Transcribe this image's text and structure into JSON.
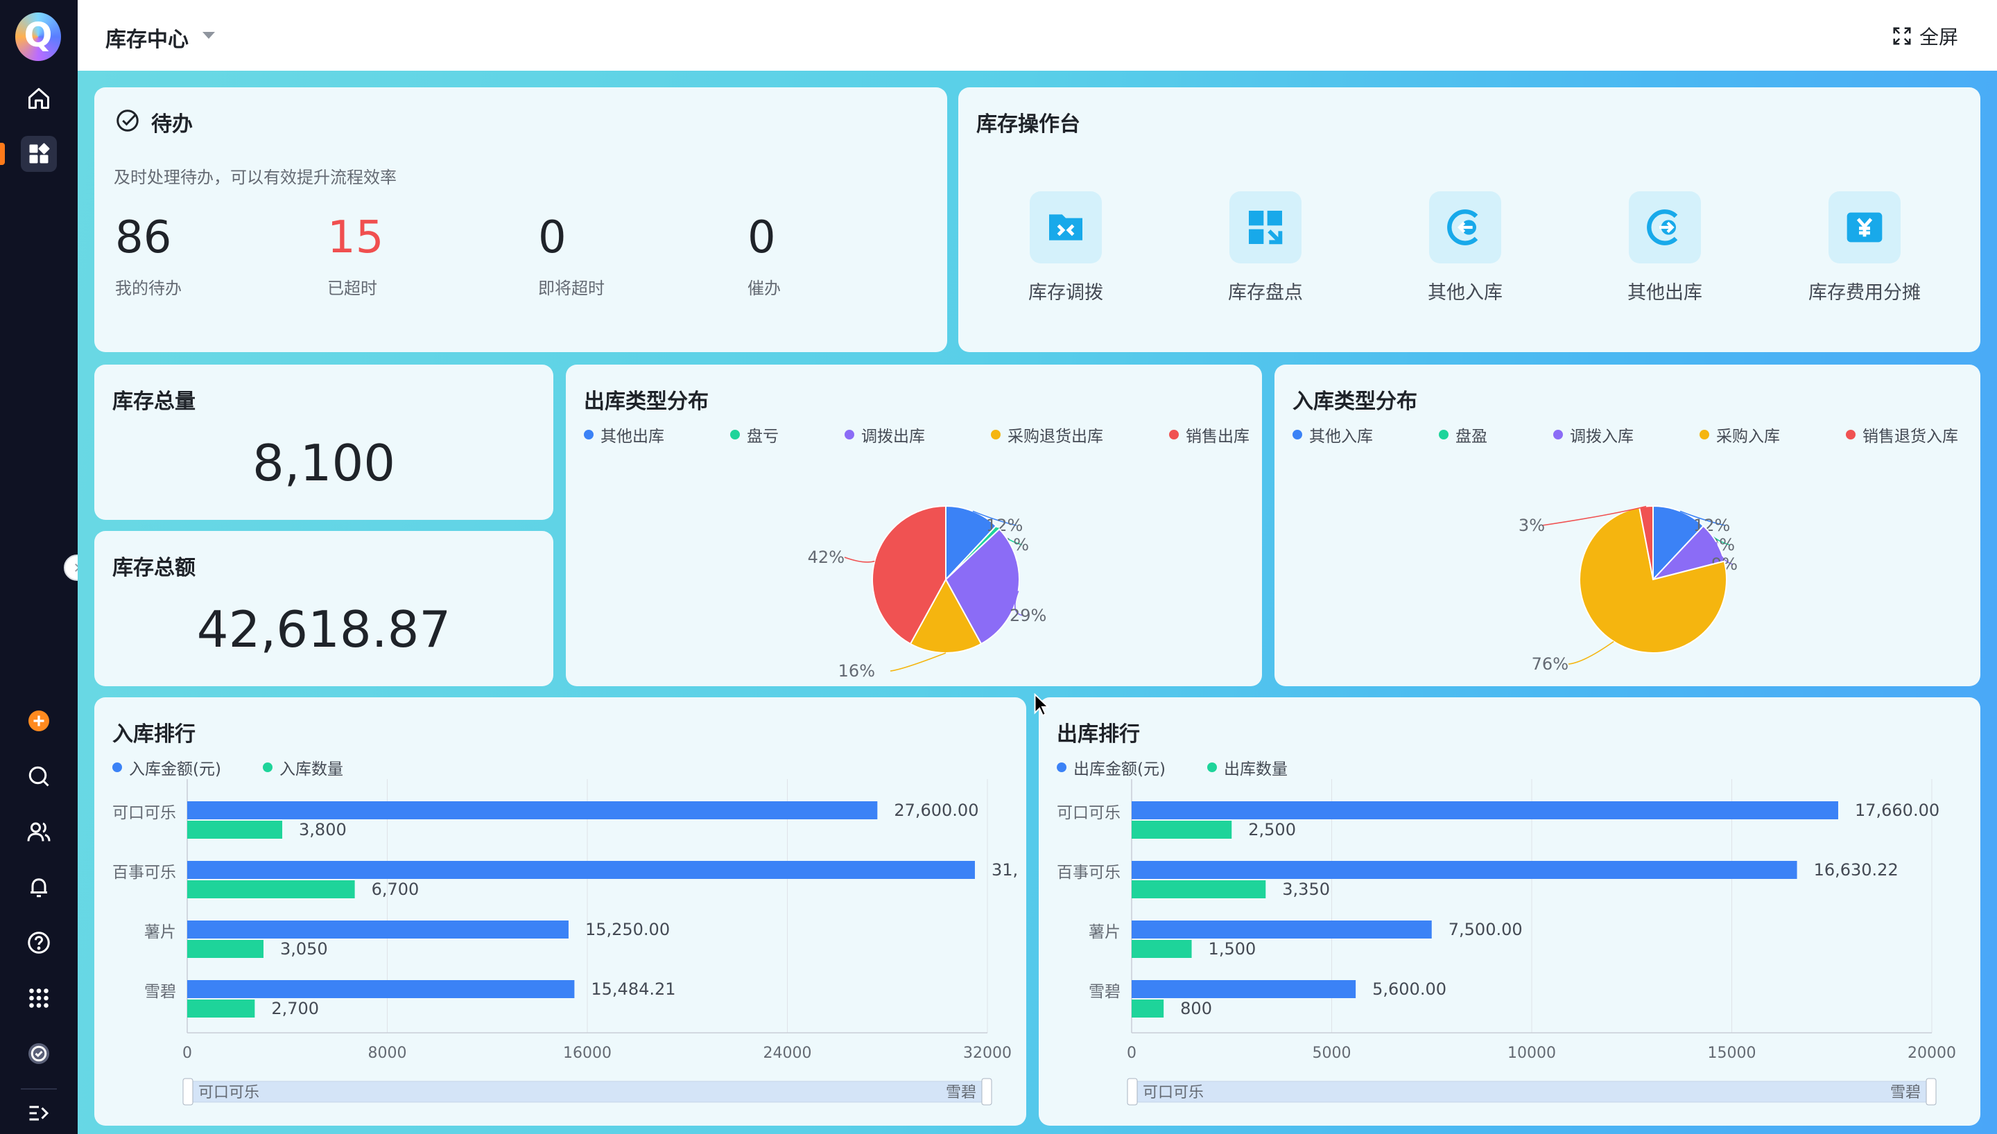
{
  "header": {
    "title": "库存中心",
    "fullscreen_label": "全屏"
  },
  "sidebar": {
    "icons": [
      "home-icon",
      "dashboard-icon",
      "add-icon",
      "search-icon",
      "users-icon",
      "bell-icon",
      "help-icon",
      "apps-icon",
      "check-circle-icon",
      "expand-menu-icon"
    ]
  },
  "todo": {
    "title": "待办",
    "subtitle": "及时处理待办，可以有效提升流程效率",
    "items": [
      {
        "value": "86",
        "label": "我的待办"
      },
      {
        "value": "15",
        "label": "已超时"
      },
      {
        "value": "0",
        "label": "即将超时"
      },
      {
        "value": "0",
        "label": "催办"
      }
    ]
  },
  "ops": {
    "title": "库存操作台",
    "items": [
      {
        "label": "库存调拨",
        "icon": "transfer-icon"
      },
      {
        "label": "库存盘点",
        "icon": "inventory-check-icon"
      },
      {
        "label": "其他入库",
        "icon": "stock-in-icon"
      },
      {
        "label": "其他出库",
        "icon": "stock-out-icon"
      },
      {
        "label": "库存费用分摊",
        "icon": "yen-icon"
      }
    ]
  },
  "stock_total": {
    "title": "库存总量",
    "value": "8,100"
  },
  "stock_amount": {
    "title": "库存总额",
    "value": "42,618.87"
  },
  "colors": {
    "blue": "#3b82f6",
    "green": "#1ed49a",
    "purple": "#8b6cf6",
    "yellow": "#f5b50f",
    "red": "#f05252",
    "accent": "#ff7a1a"
  },
  "chart_data": [
    {
      "type": "pie",
      "title": "出库类型分布",
      "legend": [
        "其他出库",
        "盘亏",
        "调拨出库",
        "采购退货出库",
        "销售出库"
      ],
      "values": [
        12,
        1,
        29,
        16,
        42
      ],
      "labels": [
        "12%",
        "1%",
        "29%",
        "16%",
        "42%"
      ]
    },
    {
      "type": "pie",
      "title": "入库类型分布",
      "legend": [
        "其他入库",
        "盘盈",
        "调拨入库",
        "采购入库",
        "销售退货入库"
      ],
      "values": [
        12,
        0,
        9,
        76,
        3
      ],
      "labels": [
        "12%",
        "0%",
        "9%",
        "76%",
        "3%"
      ]
    },
    {
      "type": "bar",
      "title": "入库排行",
      "categories": [
        "可口可乐",
        "百事可乐",
        "薯片",
        "雪碧"
      ],
      "series": [
        {
          "name": "入库金额(元)",
          "values": [
            27600,
            31500,
            15250,
            15484.21
          ],
          "labels": [
            "27,600.00",
            "31,",
            "15,250.00",
            "15,484.21"
          ]
        },
        {
          "name": "入库数量",
          "values": [
            3800,
            6700,
            3050,
            2700
          ],
          "labels": [
            "3,800",
            "6,700",
            "3,050",
            "2,700"
          ]
        }
      ],
      "xlim": [
        0,
        32000
      ],
      "xticks": [
        "0",
        "8000",
        "16000",
        "24000",
        "32000"
      ],
      "zoom": {
        "start": "可口可乐",
        "end": "雪碧"
      }
    },
    {
      "type": "bar",
      "title": "出库排行",
      "categories": [
        "可口可乐",
        "百事可乐",
        "薯片",
        "雪碧"
      ],
      "series": [
        {
          "name": "出库金额(元)",
          "values": [
            17660,
            16630.22,
            7500,
            5600
          ],
          "labels": [
            "17,660.00",
            "16,630.22",
            "7,500.00",
            "5,600.00"
          ]
        },
        {
          "name": "出库数量",
          "values": [
            2500,
            3350,
            1500,
            800
          ],
          "labels": [
            "2,500",
            "3,350",
            "1,500",
            "800"
          ]
        }
      ],
      "xlim": [
        0,
        20000
      ],
      "xticks": [
        "0",
        "5000",
        "10000",
        "15000",
        "20000"
      ],
      "zoom": {
        "start": "可口可乐",
        "end": "雪碧"
      }
    }
  ]
}
